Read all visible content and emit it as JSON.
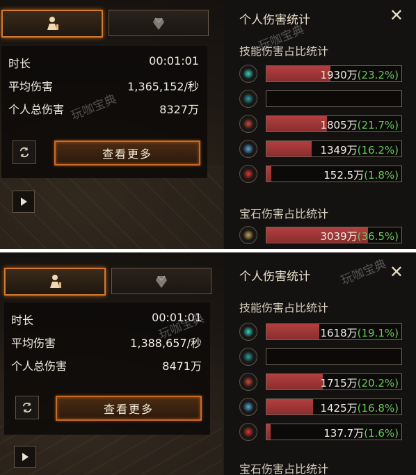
{
  "watermark": "玩咖宝典",
  "screens": [
    {
      "tabs": [
        {
          "icon": "stats-icon",
          "active": true
        },
        {
          "icon": "gem-icon",
          "active": false
        }
      ],
      "stats": [
        {
          "label": "时长",
          "value": "00:01:01"
        },
        {
          "label": "平均伤害",
          "value": "1,365,152/秒"
        },
        {
          "label": "个人总伤害",
          "value": "8327万"
        }
      ],
      "more_button": "查看更多",
      "panel_title": "个人伤害统计",
      "skill_section": "技能伤害占比统计",
      "skills": [
        {
          "icon": "skill-icon-1",
          "color": "#38d3bf",
          "number": "1930万",
          "pct": "(23.2%)",
          "fraction": 0.232
        },
        {
          "icon": "skill-icon-2",
          "color": "#2f9fa0",
          "number": "",
          "pct": "",
          "fraction": 0
        },
        {
          "icon": "skill-icon-3",
          "color": "#d24a3a",
          "number": "1805万",
          "pct": "(21.7%)",
          "fraction": 0.217
        },
        {
          "icon": "skill-icon-4",
          "color": "#5aa7d8",
          "number": "1349万",
          "pct": "(16.2%)",
          "fraction": 0.162
        },
        {
          "icon": "skill-icon-5",
          "color": "#e0392f",
          "number": "152.5万",
          "pct": "(1.8%)",
          "fraction": 0.018
        }
      ],
      "gem_section": "宝石伤害占比统计",
      "gems": [
        {
          "icon": "gem-slot-icon",
          "color": "#c9a25a",
          "number": "3039万",
          "pct": "(36.5%)",
          "fraction": 0.365
        }
      ]
    },
    {
      "tabs": [
        {
          "icon": "stats-icon",
          "active": true
        },
        {
          "icon": "gem-icon",
          "active": false
        }
      ],
      "stats": [
        {
          "label": "时长",
          "value": "00:01:01"
        },
        {
          "label": "平均伤害",
          "value": "1,388,657/秒"
        },
        {
          "label": "个人总伤害",
          "value": "8471万"
        }
      ],
      "more_button": "查看更多",
      "panel_title": "个人伤害统计",
      "skill_section": "技能伤害占比统计",
      "skills": [
        {
          "icon": "skill-icon-1",
          "color": "#38d3bf",
          "number": "1618万",
          "pct": "(19.1%)",
          "fraction": 0.191
        },
        {
          "icon": "skill-icon-2",
          "color": "#2f9fa0",
          "number": "",
          "pct": "",
          "fraction": 0
        },
        {
          "icon": "skill-icon-3",
          "color": "#d24a3a",
          "number": "1715万",
          "pct": "(20.2%)",
          "fraction": 0.202
        },
        {
          "icon": "skill-icon-4",
          "color": "#5aa7d8",
          "number": "1425万",
          "pct": "(16.8%)",
          "fraction": 0.168
        },
        {
          "icon": "skill-icon-5",
          "color": "#e0392f",
          "number": "137.7万",
          "pct": "(1.6%)",
          "fraction": 0.016
        }
      ],
      "gem_section": "宝石伤害占比统计",
      "gems": []
    }
  ]
}
